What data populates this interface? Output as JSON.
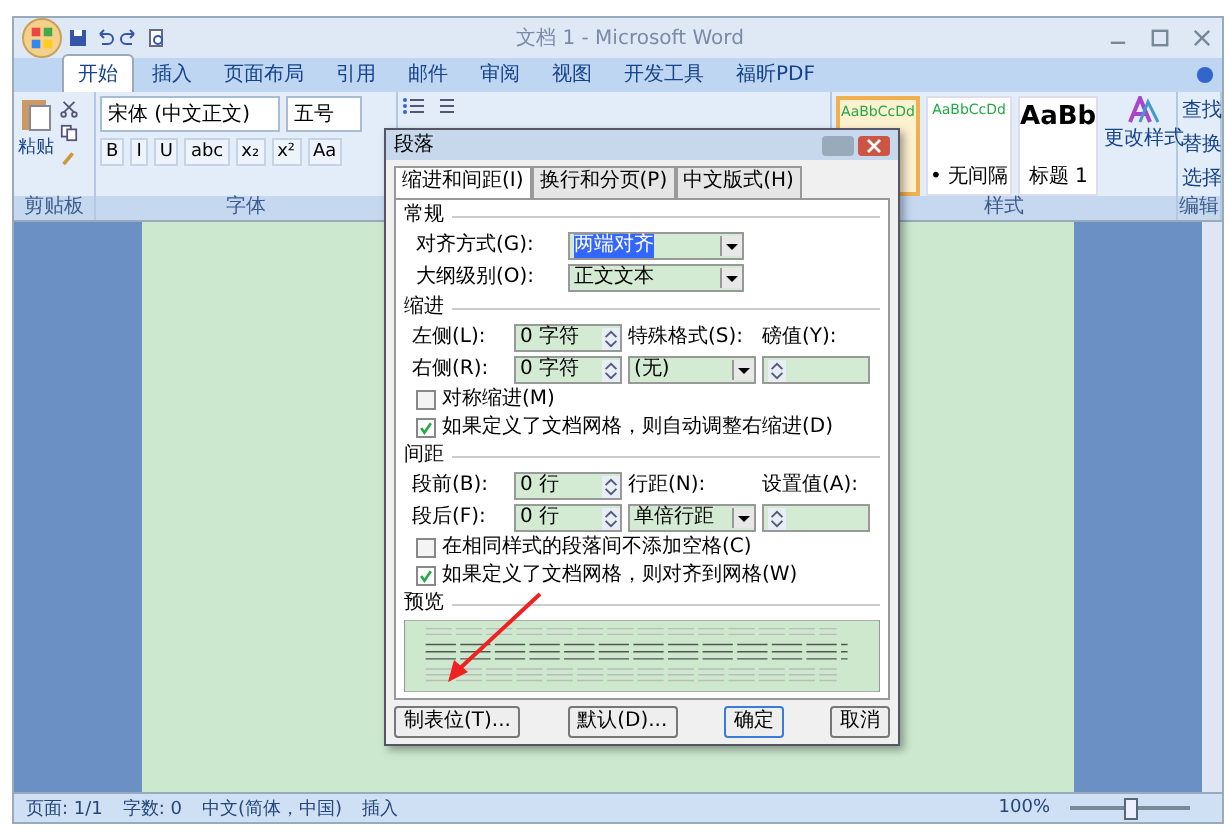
{
  "window": {
    "title": "文档 1 - Microsoft Word"
  },
  "ribbon_tabs": [
    {
      "label": "开始",
      "selected": true
    },
    {
      "label": "插入",
      "selected": false
    },
    {
      "label": "页面布局",
      "selected": false
    },
    {
      "label": "引用",
      "selected": false
    },
    {
      "label": "邮件",
      "selected": false
    },
    {
      "label": "审阅",
      "selected": false
    },
    {
      "label": "视图",
      "selected": false
    },
    {
      "label": "开发工具",
      "selected": false
    },
    {
      "label": "福昕PDF",
      "selected": false
    }
  ],
  "clipboard": {
    "paste": "粘贴",
    "group": "剪贴板"
  },
  "font": {
    "name": "宋体 (中文正文)",
    "size": "五号",
    "buttons": [
      "B",
      "I",
      "U",
      "abc",
      "x₂",
      "x²",
      "Aa"
    ],
    "group": "字体"
  },
  "styles": {
    "items": [
      {
        "sample": "AaBbCcDd",
        "selected": true
      },
      {
        "sample": "AaBbCcDd",
        "label": "• 无间隔",
        "selected": false
      },
      {
        "sample": "AaBb",
        "label": "标题 1",
        "selected": false
      }
    ],
    "change": "更改样式",
    "group": "样式"
  },
  "editing": {
    "items": [
      "查找",
      "替换",
      "选择"
    ],
    "group": "编辑"
  },
  "dialog": {
    "title": "段落",
    "tabs": [
      {
        "label": "缩进和间距(I)",
        "selected": true
      },
      {
        "label": "换行和分页(P)",
        "selected": false
      },
      {
        "label": "中文版式(H)",
        "selected": false
      }
    ],
    "general": {
      "heading": "常规",
      "alignment": {
        "label": "对齐方式(G):",
        "value": "两端对齐"
      },
      "outline": {
        "label": "大纲级别(O):",
        "value": "正文文本"
      }
    },
    "indent": {
      "heading": "缩进",
      "a": {
        "label": "左侧(L):",
        "value": "0 字符"
      },
      "b": {
        "label": "右侧(R):",
        "value": "0 字符"
      },
      "c": {
        "label": "特殊格式(S):",
        "value": "(无)"
      },
      "d": {
        "label": "磅值(Y):"
      },
      "checks": [
        {
          "label": "对称缩进(M)",
          "checked": false
        },
        {
          "label": "如果定义了文档网格，则自动调整右缩进(D)",
          "checked": true
        }
      ]
    },
    "spacing": {
      "heading": "间距",
      "a": {
        "label": "段前(B):",
        "value": "0 行"
      },
      "b": {
        "label": "段后(F):",
        "value": "0 行"
      },
      "c": {
        "label": "行距(N):",
        "value": "单倍行距"
      },
      "d": {
        "label": "设置值(A):"
      },
      "checks": [
        {
          "label": "在相同样式的段落间不添加空格(C)",
          "checked": false
        },
        {
          "label": "如果定义了文档网格，则对齐到网格(W)",
          "checked": true
        }
      ]
    },
    "preview": {
      "heading": "预览"
    },
    "buttons": [
      "制表位(T)...",
      "默认(D)...",
      "确定",
      "取消"
    ]
  },
  "status_bar": {
    "items": [
      "页面: 1/1",
      "字数: 0",
      "中文(简体，中国)",
      "插入"
    ],
    "zoom": "100%",
    "level": 0.5
  }
}
